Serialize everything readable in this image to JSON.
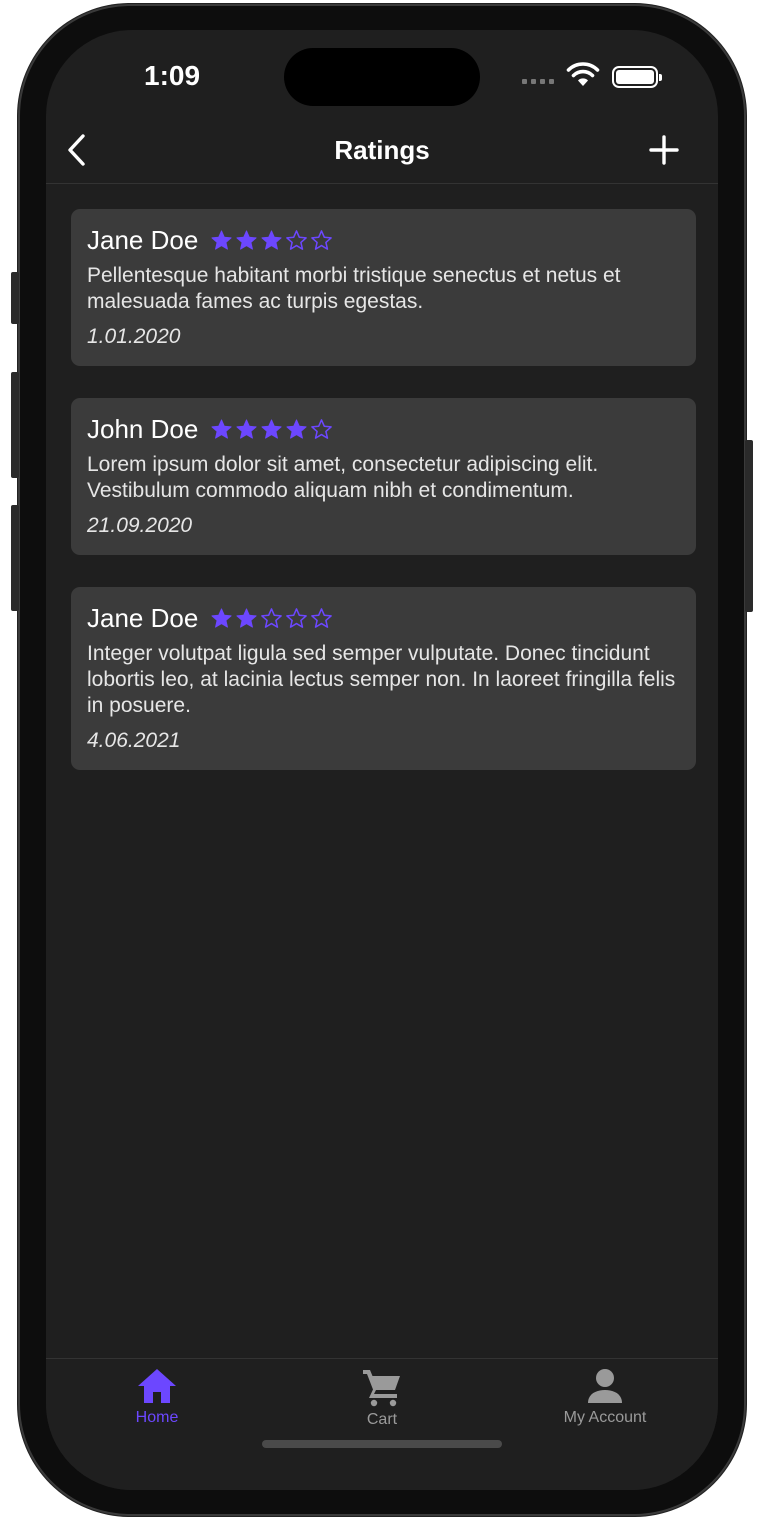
{
  "status": {
    "time": "1:09"
  },
  "header": {
    "title": "Ratings"
  },
  "colors": {
    "accent": "#6c47ff",
    "card": "#3b3b3b",
    "background": "#1f1f1f",
    "inactive": "#9a9a9a"
  },
  "ratings": [
    {
      "author": "Jane Doe",
      "stars": 3,
      "max_stars": 5,
      "comment": "Pellentesque habitant morbi tristique senectus et netus et malesuada fames ac turpis egestas.",
      "date": "1.01.2020"
    },
    {
      "author": "John Doe",
      "stars": 4,
      "max_stars": 5,
      "comment": "Lorem ipsum dolor sit amet, consectetur adipiscing elit. Vestibulum commodo aliquam nibh et condimentum.",
      "date": "21.09.2020"
    },
    {
      "author": "Jane Doe",
      "stars": 2,
      "max_stars": 5,
      "comment": "Integer volutpat ligula sed semper vulputate. Donec tincidunt lobortis leo, at lacinia lectus semper non. In laoreet fringilla felis in posuere.",
      "date": "4.06.2021"
    }
  ],
  "tabs": [
    {
      "label": "Home",
      "icon": "home-icon",
      "active": true
    },
    {
      "label": "Cart",
      "icon": "cart-icon",
      "active": false
    },
    {
      "label": "My Account",
      "icon": "account-icon",
      "active": false
    }
  ]
}
